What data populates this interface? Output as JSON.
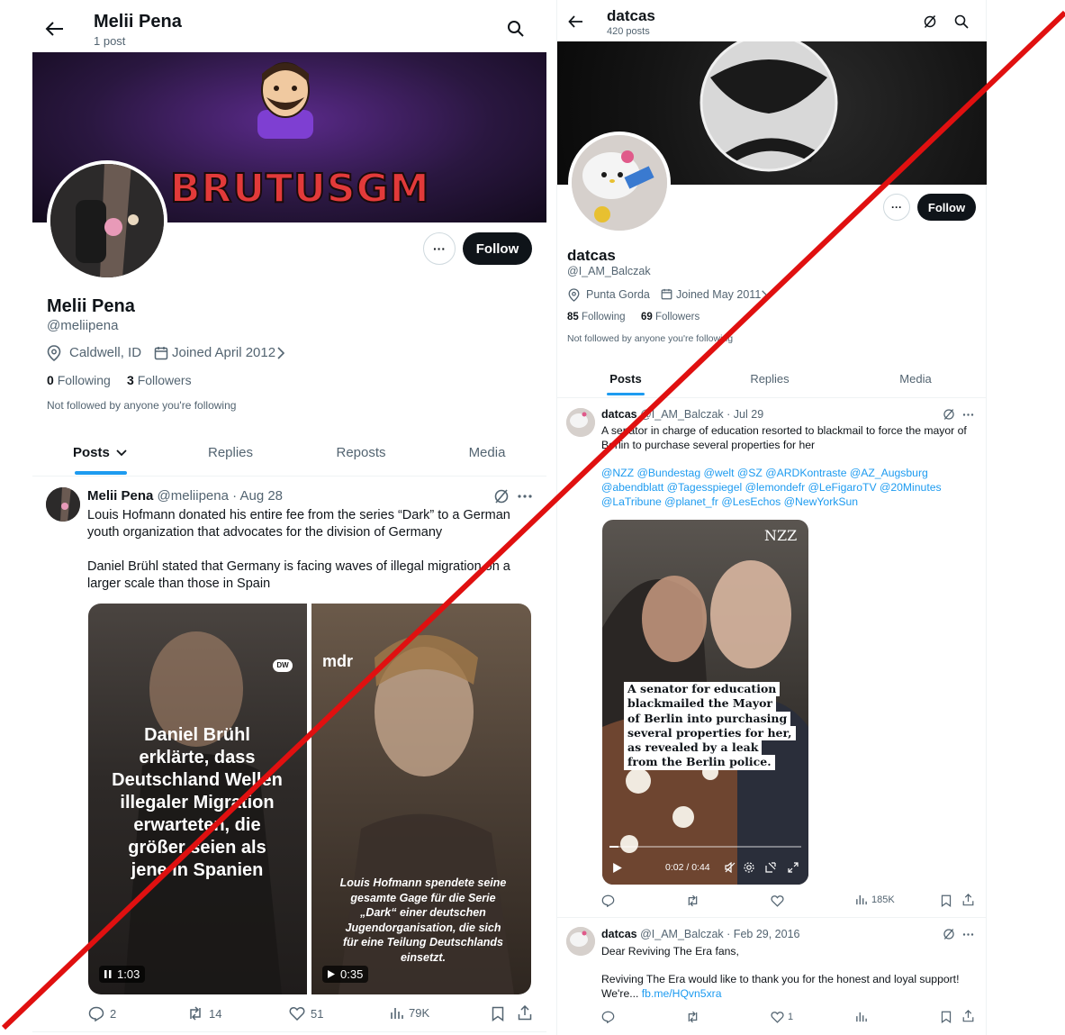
{
  "left": {
    "header": {
      "name": "Melii Pena",
      "post_count": "1 post"
    },
    "banner": {
      "logo_text": "BRUTUSGM"
    },
    "profile": {
      "name": "Melii Pena",
      "handle": "@meliipena",
      "location": "Caldwell, ID",
      "joined": "Joined April 2012",
      "following_count": "0",
      "following_label": "Following",
      "followers_count": "3",
      "followers_label": "Followers",
      "not_followed": "Not followed by anyone you're following",
      "follow_label": "Follow",
      "more_label": "···"
    },
    "tabs": [
      "Posts",
      "Replies",
      "Reposts",
      "Media"
    ],
    "post": {
      "name": "Melii Pena",
      "handle": "@meliipena",
      "date": "· Aug 28",
      "text1": "Louis Hofmann donated his entire fee from the series “Dark” to a German youth organization that advocates for the division of Germany",
      "text2": "Daniel Brühl stated that Germany is facing waves of illegal migration on a larger scale than those in Spain",
      "video1": {
        "caption": "Daniel Brühl erklärte, dass Deutschland Wellen illegaler Migration erwarteten, die größer seien als jene in Spanien",
        "duration": "1:03",
        "badge": "DW"
      },
      "video2": {
        "caption": "Louis Hofmann spendete seine gesamte Gage für die Serie „Dark“ einer deutschen Jugendorganisation, die sich für eine Teilung Deutschlands einsetzt.",
        "duration": "0:35",
        "badge": "mdr"
      },
      "replies": "2",
      "reposts": "14",
      "likes": "51",
      "views": "79K"
    }
  },
  "right": {
    "header": {
      "name": "datcas",
      "post_count": "420 posts"
    },
    "profile": {
      "name": "datcas",
      "handle": "@I_AM_Balczak",
      "location": "Punta Gorda",
      "joined": "Joined May 2011",
      "following_count": "85",
      "following_label": "Following",
      "followers_count": "69",
      "followers_label": "Followers",
      "not_followed": "Not followed by anyone you're following",
      "follow_label": "Follow",
      "more_label": "···"
    },
    "tabs": [
      "Posts",
      "Replies",
      "Media"
    ],
    "post1": {
      "name": "datcas",
      "handle": "@I_AM_Balczak",
      "date": "· Jul 29",
      "text": "A senator in charge of education resorted to blackmail to force the mayor of Berlin to purchase several properties for her",
      "mentions1": "@NZZ @Bundestag @welt @SZ @ARDKontraste @AZ_Augsburg",
      "mentions2": "@abendblatt @Tagesspiegel @lemondefr @LeFigaroTV @20Minutes",
      "mentions3": "@LaTribune @planet_fr @LesEchos @NewYorkSun",
      "video": {
        "badge": "NZZ",
        "caption_lines": [
          "A senator for education",
          "blackmailed the Mayor",
          "of Berlin into purchasing",
          "several properties for her,",
          "as revealed by a leak",
          "from the Berlin police."
        ],
        "time": "0:02 / 0:44",
        "progress": 0.045
      },
      "views": "185K"
    },
    "post2": {
      "name": "datcas",
      "handle": "@I_AM_Balczak",
      "date": "· Feb 29, 2016",
      "text1": "Dear Reviving The Era fans,",
      "text2": "Reviving The Era would like to thank you for the honest and loyal support! We're...",
      "link": "fb.me/HQvn5xra",
      "likes": "1"
    }
  },
  "colors": {
    "accent": "#1d9bf0",
    "strike": "#e01010",
    "text": "#0f1419",
    "muted": "#536471"
  }
}
